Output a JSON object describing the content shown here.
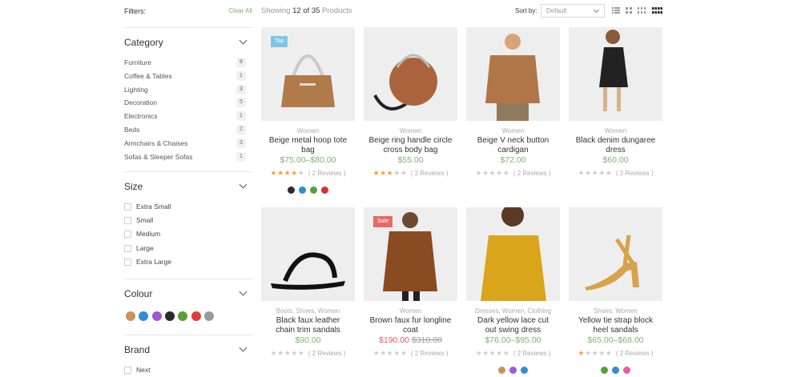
{
  "filters": {
    "label": "Filters:",
    "clear_all": "Clear All"
  },
  "category": {
    "title": "Category",
    "items": [
      {
        "label": "Furniture",
        "count": "8"
      },
      {
        "label": "Coffee & Tables",
        "count": "1"
      },
      {
        "label": "Lighting",
        "count": "3"
      },
      {
        "label": "Decoration",
        "count": "5"
      },
      {
        "label": "Electronics",
        "count": "1"
      },
      {
        "label": "Beds",
        "count": "2"
      },
      {
        "label": "Armchairs & Chaises",
        "count": "3"
      },
      {
        "label": "Sofas & Sleeper Sofas",
        "count": "1"
      }
    ]
  },
  "size": {
    "title": "Size",
    "items": [
      "Extra Small",
      "Small",
      "Medium",
      "Large",
      "Extra Large"
    ]
  },
  "colour": {
    "title": "Colour",
    "swatches": [
      "#c8935a",
      "#2e8fd1",
      "#9b59d6",
      "#2b2b2b",
      "#5a9e3a",
      "#e03a3a",
      "#999999"
    ]
  },
  "brand": {
    "title": "Brand",
    "items": [
      "Next"
    ]
  },
  "toolbar": {
    "showing_prefix": "Showing",
    "showing_from": "12",
    "showing_of": "of",
    "showing_total": "35",
    "showing_suffix": "Products",
    "sort_label": "Sort by:",
    "sort_value": "Default"
  },
  "colors": {
    "accent": "#7fb26f",
    "sale": "#e05a5a",
    "badge_top": "#7ec6e7",
    "badge_sale": "#e76a6a",
    "star": "#f2a530"
  },
  "products": [
    {
      "badge": "Top",
      "badge_type": "top",
      "category": "Women",
      "name": "Beige metal hoop tote bag",
      "price": "$75.00–$80.00",
      "rating": 4,
      "reviews": "( 2 Reviews )",
      "swatches": [
        "#2b2b2b",
        "#2e8fd1",
        "#5a9e3a",
        "#d93030"
      ]
    },
    {
      "badge": "",
      "badge_type": "",
      "category": "Women",
      "name": "Beige ring handle circle cross body bag",
      "price": "$55.00",
      "rating": 3,
      "reviews": "( 2 Reviews )",
      "swatches": []
    },
    {
      "badge": "",
      "badge_type": "",
      "category": "Women",
      "name": "Beige V neck button cardigan",
      "price": "$72.00",
      "rating": 0,
      "reviews": "( 2 Reviews )",
      "swatches": []
    },
    {
      "badge": "",
      "badge_type": "",
      "category": "Women",
      "name": "Black denim dungaree dress",
      "price": "$60.00",
      "rating": 0,
      "reviews": "( 2 Reviews )",
      "swatches": []
    },
    {
      "badge": "",
      "badge_type": "",
      "category": "Boots, Shoes, Women",
      "name": "Black faux leather chain trim sandals",
      "price": "$90.00",
      "rating": 0,
      "reviews": "( 2 Reviews )",
      "swatches": []
    },
    {
      "badge": "Sale",
      "badge_type": "sale",
      "category": "Women",
      "name": "Brown faux fur longline coat",
      "price": "$190.00",
      "old_price": "$310.00",
      "rating": 0,
      "reviews": "( 2 Reviews )",
      "swatches": []
    },
    {
      "badge": "",
      "badge_type": "",
      "category": "Dresses, Women, Clothing",
      "name": "Dark yellow lace cut out swing dress",
      "price": "$76.00–$95.00",
      "rating": 0,
      "reviews": "( 2 Reviews )",
      "swatches": [
        "#c8935a",
        "#9b59d6",
        "#2e8fd1"
      ]
    },
    {
      "badge": "",
      "badge_type": "",
      "category": "Shoes, Women",
      "name": "Yellow tie strap block heel sandals",
      "price": "$65.00–$68.00",
      "rating": 1,
      "reviews": "( 2 Reviews )",
      "swatches": [
        "#5a9e3a",
        "#2e8fd1",
        "#e85a9e"
      ]
    }
  ]
}
